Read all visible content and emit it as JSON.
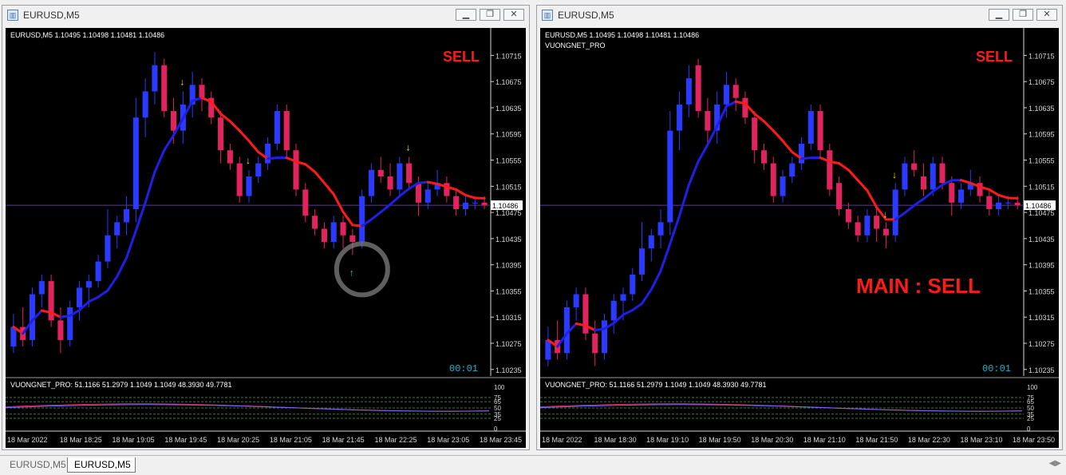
{
  "windows": [
    {
      "title": "EURUSD,M5",
      "info_line": "EURUSD,M5  1.10495 1.10498 1.10481 1.10486",
      "subtitle": "",
      "signal": "SELL",
      "main_signal": "",
      "current_price": "1.10486",
      "timer": "00:01",
      "price_ticks": [
        "1.10715",
        "1.10675",
        "1.10635",
        "1.10595",
        "1.10555",
        "1.10515",
        "1.10475",
        "1.10435",
        "1.10395",
        "1.10355",
        "1.10315",
        "1.10275",
        "1.10235"
      ],
      "osc_label": "VUONGNET_PRO:  51.1166 51.2979 1.1049 1.1049 48.3930 49.7781",
      "osc_ticks": [
        "100",
        "75",
        "65",
        "50",
        "35",
        "25",
        "0"
      ],
      "time_ticks": [
        "18 Mar 2022",
        "18 Mar 18:25",
        "18 Mar 19:05",
        "18 Mar 19:45",
        "18 Mar 20:25",
        "18 Mar 21:05",
        "18 Mar 21:45",
        "18 Mar 22:25",
        "18 Mar 23:05",
        "18 Mar 23:45"
      ]
    },
    {
      "title": "EURUSD,M5",
      "info_line": "EURUSD,M5  1.10495 1.10498 1.10481 1.10486",
      "subtitle": "VUONGNET_PRO",
      "signal": "SELL",
      "main_signal": "MAIN : SELL",
      "current_price": "1.10486",
      "timer": "00:01",
      "price_ticks": [
        "1.10715",
        "1.10675",
        "1.10635",
        "1.10595",
        "1.10555",
        "1.10515",
        "1.10475",
        "1.10435",
        "1.10395",
        "1.10355",
        "1.10315",
        "1.10275",
        "1.10235"
      ],
      "osc_label": "VUONGNET_PRO:  51.1166 51.2979 1.1049 1.1049 48.3930 49.7781",
      "osc_ticks": [
        "100",
        "75",
        "65",
        "50",
        "35",
        "25",
        "0"
      ],
      "time_ticks": [
        "18 Mar 2022",
        "18 Mar 18:30",
        "18 Mar 19:10",
        "18 Mar 19:50",
        "18 Mar 20:30",
        "18 Mar 21:10",
        "18 Mar 21:50",
        "18 Mar 22:30",
        "18 Mar 23:10",
        "18 Mar 23:50"
      ]
    }
  ],
  "tabs": [
    "EURUSD,M5",
    "EURUSD,M5"
  ],
  "colors": {
    "bull": "#2a3bff",
    "bear": "#e0245e",
    "trend_up": "#1f1fe6",
    "trend_down": "#ff1a1a",
    "signal_text": "#ff1a1a",
    "arrow_down": "#ffe400",
    "arrow_up": "#19d3e6",
    "grid_dash": "#3a7a3a",
    "price_line": "#5a3a9a",
    "timer": "#18b6c8"
  },
  "chart_data": [
    {
      "type": "candlestick",
      "symbol": "EURUSD",
      "timeframe": "M5",
      "ylim": [
        1.10225,
        1.10735
      ],
      "candles": [
        [
          1.1027,
          1.1032,
          1.1026,
          1.103
        ],
        [
          1.103,
          1.1033,
          1.1027,
          1.1028
        ],
        [
          1.1028,
          1.1036,
          1.1027,
          1.1035
        ],
        [
          1.1035,
          1.1038,
          1.1033,
          1.1037
        ],
        [
          1.1037,
          1.1038,
          1.103,
          1.1031
        ],
        [
          1.1031,
          1.1033,
          1.1026,
          1.1028
        ],
        [
          1.1028,
          1.1034,
          1.1027,
          1.1033
        ],
        [
          1.1033,
          1.1037,
          1.1031,
          1.1036
        ],
        [
          1.1036,
          1.1038,
          1.1033,
          1.1037
        ],
        [
          1.1037,
          1.1041,
          1.1036,
          1.104
        ],
        [
          1.104,
          1.1048,
          1.1039,
          1.1044
        ],
        [
          1.1044,
          1.1047,
          1.1042,
          1.1046
        ],
        [
          1.1046,
          1.105,
          1.1044,
          1.1048
        ],
        [
          1.1048,
          1.1065,
          1.1046,
          1.1062
        ],
        [
          1.1062,
          1.1068,
          1.1059,
          1.1066
        ],
        [
          1.1066,
          1.1072,
          1.1064,
          1.107
        ],
        [
          1.107,
          1.1071,
          1.1062,
          1.1063
        ],
        [
          1.1063,
          1.1065,
          1.1058,
          1.106
        ],
        [
          1.106,
          1.1066,
          1.1058,
          1.1064
        ],
        [
          1.1064,
          1.1069,
          1.1062,
          1.1067
        ],
        [
          1.1067,
          1.1068,
          1.1063,
          1.1065
        ],
        [
          1.1065,
          1.1066,
          1.1061,
          1.1062
        ],
        [
          1.1062,
          1.1063,
          1.1055,
          1.1057
        ],
        [
          1.1057,
          1.1058,
          1.1054,
          1.1055
        ],
        [
          1.1055,
          1.1056,
          1.1049,
          1.105
        ],
        [
          1.105,
          1.1054,
          1.1049,
          1.1053
        ],
        [
          1.1053,
          1.1056,
          1.1052,
          1.1055
        ],
        [
          1.1055,
          1.1059,
          1.1054,
          1.1058
        ],
        [
          1.1058,
          1.1064,
          1.1057,
          1.1063
        ],
        [
          1.1063,
          1.1064,
          1.1056,
          1.1057
        ],
        [
          1.1057,
          1.1058,
          1.105,
          1.1051
        ],
        [
          1.1051,
          1.1052,
          1.1046,
          1.1047
        ],
        [
          1.1047,
          1.1048,
          1.1044,
          1.1045
        ],
        [
          1.1045,
          1.1046,
          1.1042,
          1.1043
        ],
        [
          1.1043,
          1.1047,
          1.1042,
          1.1046
        ],
        [
          1.1046,
          1.1047,
          1.1042,
          1.1044
        ],
        [
          1.1044,
          1.1045,
          1.1041,
          1.1043
        ],
        [
          1.1043,
          1.1051,
          1.1042,
          1.105
        ],
        [
          1.105,
          1.1055,
          1.1049,
          1.1054
        ],
        [
          1.1054,
          1.1056,
          1.1052,
          1.1053
        ],
        [
          1.1053,
          1.1055,
          1.105,
          1.1051
        ],
        [
          1.1051,
          1.1056,
          1.105,
          1.1055
        ],
        [
          1.1055,
          1.1056,
          1.1051,
          1.1052
        ],
        [
          1.1052,
          1.1053,
          1.1047,
          1.1049
        ],
        [
          1.1049,
          1.1052,
          1.1048,
          1.1051
        ],
        [
          1.1051,
          1.1054,
          1.105,
          1.1052
        ],
        [
          1.1052,
          1.1053,
          1.1049,
          1.105
        ],
        [
          1.105,
          1.1051,
          1.1047,
          1.1048
        ],
        [
          1.1048,
          1.105,
          1.1047,
          1.1049
        ],
        [
          1.1049,
          1.105,
          1.1048,
          1.1049
        ],
        [
          1.1049,
          1.105,
          1.1048,
          1.10486
        ]
      ],
      "overlays": [
        {
          "name": "",
          "shape": "trend line, blue while rising, red while falling"
        }
      ]
    },
    {
      "type": "candlestick",
      "symbol": "EURUSD",
      "timeframe": "M5",
      "ylim": [
        1.10225,
        1.10735
      ],
      "overlays": [
        {
          "name": "",
          "shape": "trend line, blue while rising, red while falling"
        }
      ]
    }
  ]
}
